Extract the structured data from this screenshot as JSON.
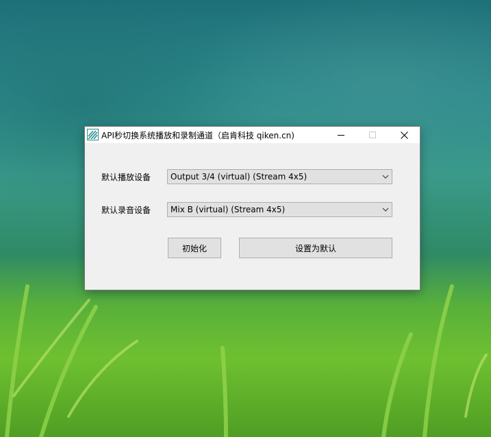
{
  "window": {
    "title": "API秒切换系统播放和录制通道（启肯科技 qiken.cn)",
    "controls": {
      "minimize_icon": "minimize-icon",
      "maximize_icon": "maximize-icon",
      "close_icon": "close-icon"
    }
  },
  "form": {
    "playback": {
      "label": "默认播放设备",
      "value": "Output 3/4 (virtual) (Stream 4x5)"
    },
    "recording": {
      "label": "默认录音设备",
      "value": "Mix B (virtual) (Stream 4x5)"
    },
    "init_button": "初始化",
    "set_default_button": "设置为默认"
  },
  "colors": {
    "window_bg": "#f0f0f0",
    "titlebar_bg": "#ffffff",
    "control_bg": "#e1e1e1",
    "control_border": "#adadad",
    "icon_accent": "#2a8a8a"
  }
}
